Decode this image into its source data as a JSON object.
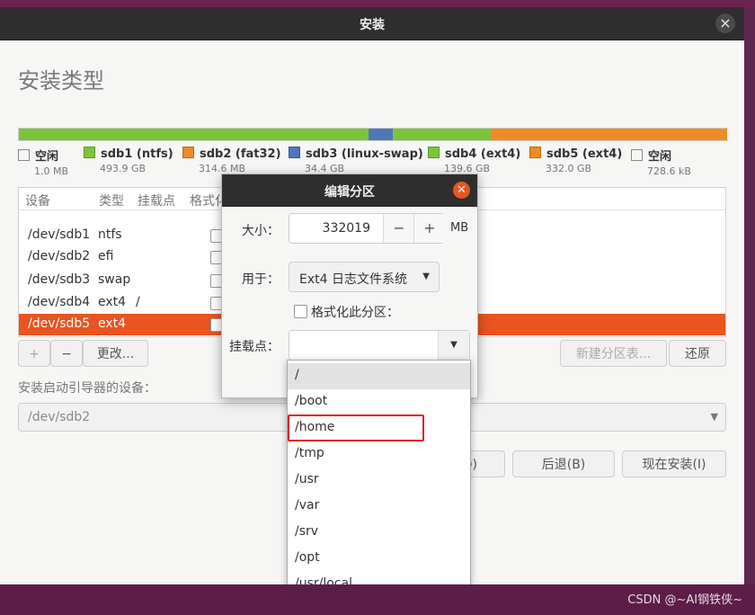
{
  "window": {
    "title": "安装",
    "close_glyph": "×"
  },
  "heading": "安装类型",
  "partition_bar": [
    {
      "name": "空闲",
      "color": "#8bc34a",
      "fraction": 0.0001
    },
    {
      "name": "sdb1",
      "color": "#7dc43a",
      "fraction": 0.492
    },
    {
      "name": "sdb2",
      "color": "#ef8a24",
      "fraction": 0.0003
    },
    {
      "name": "sdb3",
      "color": "#4f77b8",
      "fraction": 0.034
    },
    {
      "name": "sdb4",
      "color": "#7dc43a",
      "fraction": 0.139
    },
    {
      "name": "sdb5",
      "color": "#ef8a24",
      "fraction": 0.331
    },
    {
      "name": "空闲",
      "color": "#f0f0f0",
      "fraction": 0.0001
    }
  ],
  "legend": [
    {
      "name": "空闲",
      "size": "1.0 MB",
      "color": "#ffffff"
    },
    {
      "name": "sdb1 (ntfs)",
      "size": "493.9 GB",
      "color": "#7dc43a"
    },
    {
      "name": "sdb2 (fat32)",
      "size": "314.6 MB",
      "color": "#ef8a24"
    },
    {
      "name": "sdb3 (linux-swap)",
      "size": "34.4 GB",
      "color": "#4f77b8"
    },
    {
      "name": "sdb4 (ext4)",
      "size": "139.6 GB",
      "color": "#7dc43a"
    },
    {
      "name": "sdb5 (ext4)",
      "size": "332.0 GB",
      "color": "#ef8a24"
    },
    {
      "name": "空闲",
      "size": "728.6 kB",
      "color": "#ffffff"
    }
  ],
  "table": {
    "headers": [
      "设备",
      "类型",
      "挂载点",
      "格式化"
    ],
    "rows": [
      {
        "device": "/dev/sdb1",
        "type": "ntfs",
        "mount": ""
      },
      {
        "device": "/dev/sdb2",
        "type": "efi",
        "mount": ""
      },
      {
        "device": "/dev/sdb3",
        "type": "swap",
        "mount": ""
      },
      {
        "device": "/dev/sdb4",
        "type": "ext4",
        "mount": "/"
      },
      {
        "device": "/dev/sdb5",
        "type": "ext4",
        "mount": "",
        "selected": true
      }
    ]
  },
  "toolbar": {
    "add": "+",
    "remove": "−",
    "change": "更改...",
    "new_table": "新建分区表...",
    "revert": "还原"
  },
  "boot_loader": {
    "label": "安装启动引导器的设备：",
    "value": "/dev/sdb2"
  },
  "footer": {
    "back": "后退(B)",
    "install": "现在安装(I)",
    "partial": "(Q)"
  },
  "dialog": {
    "title": "编辑分区",
    "size_label": "大小：",
    "size_value": "332019",
    "size_unit": "MB",
    "minus": "−",
    "plus": "+",
    "use_label": "用于：",
    "use_value": "Ext4 日志文件系统",
    "format_label": "格式化此分区：",
    "mount_label": "挂载点：",
    "mount_value": ""
  },
  "mount_options": [
    "/",
    "/boot",
    "/home",
    "/tmp",
    "/usr",
    "/var",
    "/srv",
    "/opt",
    "/usr/local"
  ],
  "highlighted_option": "/home",
  "watermark": "CSDN @~AI钢铁侠~",
  "accent_color": "#e95420"
}
